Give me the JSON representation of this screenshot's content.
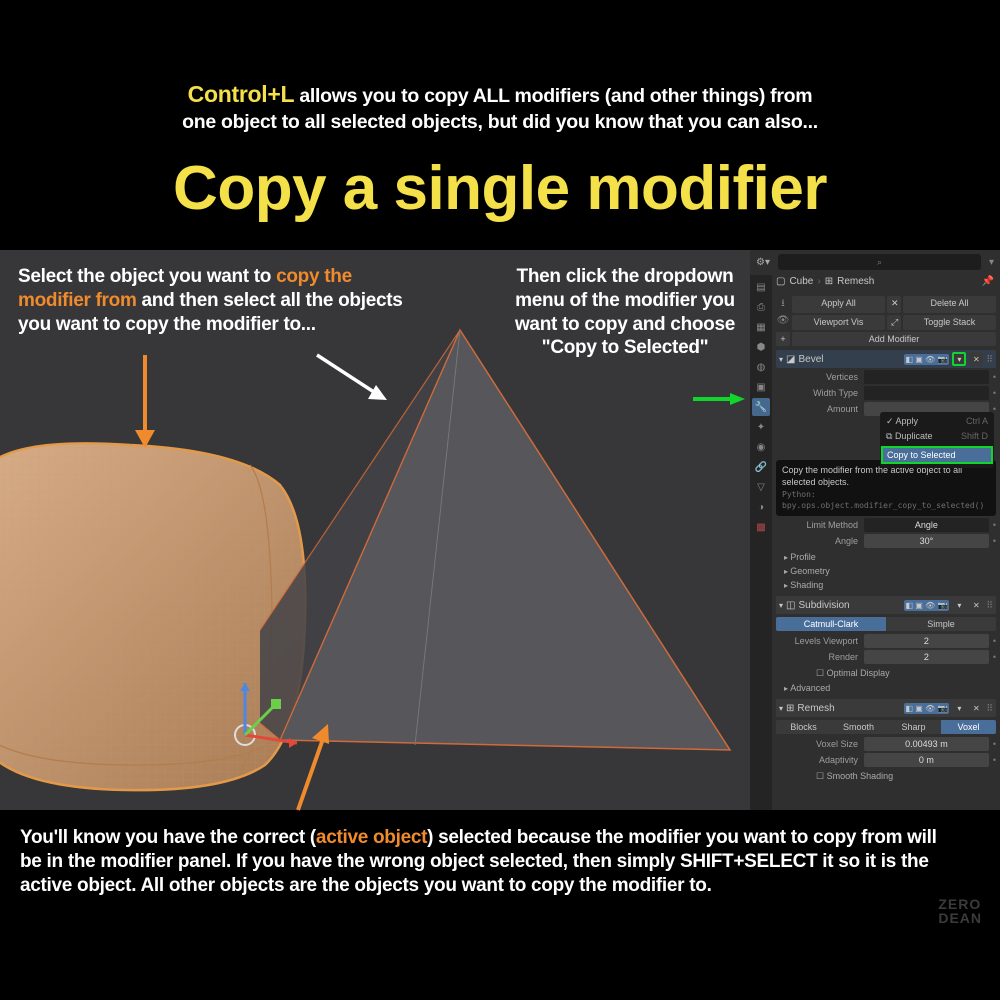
{
  "intro": {
    "kbd": "Control+L",
    "rest1": " allows you to copy ALL modifiers (and other things) from",
    "rest2": "one object to all selected objects, but did you know that you can also..."
  },
  "headline": "Copy a single modifier",
  "captions": {
    "left_pre": "Select the object you want to ",
    "left_hl": "copy the modifier from",
    "left_post": " and then select all the objects you want to copy the modifier to...",
    "right": "Then click the dropdown menu of the modifier you want to copy and choose \"Copy to Selected\""
  },
  "panel": {
    "search_ph": "⌕",
    "crumb_obj": "Cube",
    "crumb_mod": "Remesh",
    "apply_all": "Apply All",
    "delete_all": "Delete All",
    "viewport_vis": "Viewport Vis",
    "toggle_stack": "Toggle Stack",
    "add_modifier": "Add Modifier",
    "bevel": {
      "name": "Bevel",
      "vertices": "Vertices",
      "width_type": "Width Type",
      "amount": "Amount",
      "limit_method": "Limit Method",
      "limit_val": "Angle",
      "angle": "Angle",
      "angle_val": "30°",
      "profile": "Profile",
      "geometry": "Geometry",
      "shading": "Shading"
    },
    "dropdown": {
      "apply": "Apply",
      "apply_key": "Ctrl A",
      "duplicate": "Duplicate",
      "duplicate_key": "Shift D",
      "copy_to_selected": "Copy to Selected"
    },
    "tooltip": {
      "desc": "Copy the modifier from the active object to all selected objects.",
      "python": "Python: bpy.ops.object.modifier_copy_to_selected()"
    },
    "subdivision": {
      "name": "Subdivision",
      "mode_a": "Catmull-Clark",
      "mode_b": "Simple",
      "levels_viewport": "Levels Viewport",
      "levels_viewport_val": "2",
      "render": "Render",
      "render_val": "2",
      "optimal": "Optimal Display",
      "advanced": "Advanced"
    },
    "remesh": {
      "name": "Remesh",
      "blocks": "Blocks",
      "smooth": "Smooth",
      "sharp": "Sharp",
      "voxel": "Voxel",
      "voxel_size": "Voxel Size",
      "voxel_size_val": "0.00493 m",
      "adaptivity": "Adaptivity",
      "adaptivity_val": "0 m",
      "smooth_shading": "Smooth Shading"
    }
  },
  "bottom": {
    "pre": "You'll know you have the correct (",
    "hl": "active object",
    "post": ") selected because the modifier you want to copy from will be in the modifier panel. If you have the wrong object selected, then simply SHIFT+SELECT it so it is the active object. All other objects are the objects you want to copy the modifier to."
  },
  "watermark": {
    "l1": "ZERO",
    "l2": "DEAN"
  }
}
